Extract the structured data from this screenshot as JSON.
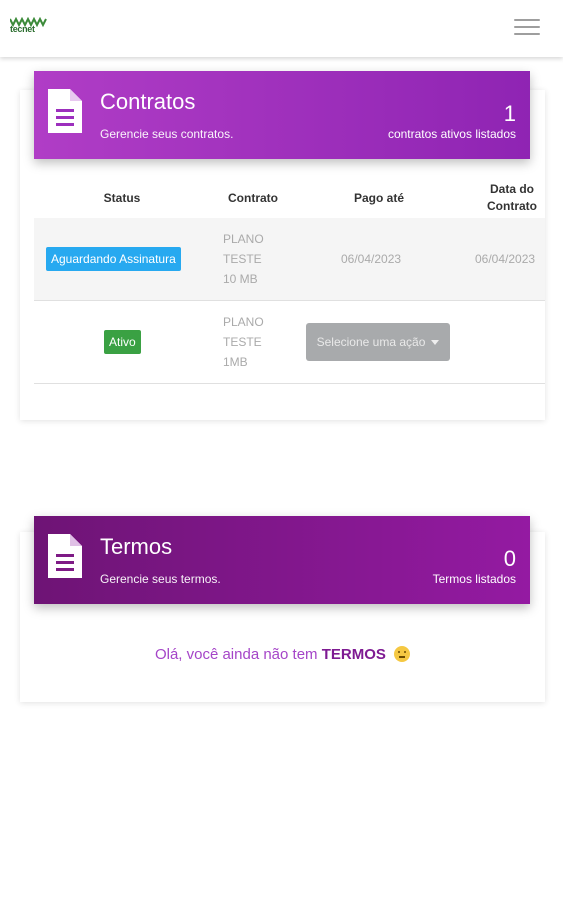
{
  "logo": {
    "text": "tecnet"
  },
  "contracts": {
    "title": "Contratos",
    "subtitle": "Gerencie seus contratos.",
    "count": "1",
    "count_label": "contratos ativos listados",
    "columns": [
      "Status",
      "Contrato",
      "Pago até",
      "Data do Contrato"
    ],
    "rows": [
      {
        "status": "Aguardando Assinatura",
        "status_color": "#27a9f0",
        "plan": [
          "PLANO",
          "TESTE",
          "10 MB"
        ],
        "paid_until": "06/04/2023",
        "contract_date": "06/04/2023"
      },
      {
        "status": "Ativo",
        "status_color": "#3aa143",
        "plan": [
          "PLANO",
          "TESTE",
          "1MB"
        ],
        "action": "Selecione uma ação"
      }
    ]
  },
  "terms": {
    "title": "Termos",
    "subtitle": "Gerencie seus termos.",
    "count": "0",
    "count_label": "Termos listados",
    "empty_prefix": "Olá, você ainda não tem ",
    "empty_strong": "TERMOS"
  },
  "colors": {
    "contracts_header": "#9c2fbd",
    "terms_header": "#7e1a85",
    "accent": "#a545c8"
  }
}
